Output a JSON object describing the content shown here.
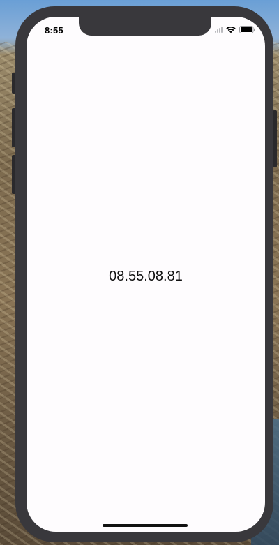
{
  "status_bar": {
    "time": "8:55",
    "icons": [
      "cellular-signal-icon",
      "wifi-icon",
      "battery-icon"
    ]
  },
  "main": {
    "label": "08.55.08.81"
  },
  "colors": {
    "screen_background": "#fefcfe",
    "device_frame": "#39383c",
    "text": "#111111"
  }
}
